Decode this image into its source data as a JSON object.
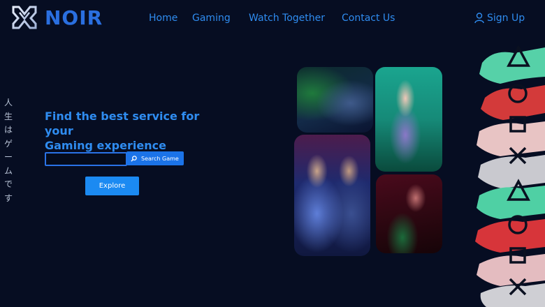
{
  "brand": {
    "name": "NOIR"
  },
  "nav": {
    "items": [
      "Home",
      "Gaming",
      "Watch Together",
      "Contact Us"
    ]
  },
  "header": {
    "signup_label": "Sign Up",
    "signup_icon": "user-icon"
  },
  "sidebar_text": [
    "人",
    "生",
    "は",
    "ゲ",
    "ー",
    "ム",
    "で",
    "す"
  ],
  "hero": {
    "headline_line1": "Find the best service for your",
    "headline_line2": "Gaming experience",
    "search_value": "",
    "search_button_label": "Search Game",
    "search_icon": "search-icon",
    "explore_label": "Explore"
  },
  "colors": {
    "background": "#060d22",
    "accent": "#2f8cf0",
    "button": "#1b73e8"
  }
}
